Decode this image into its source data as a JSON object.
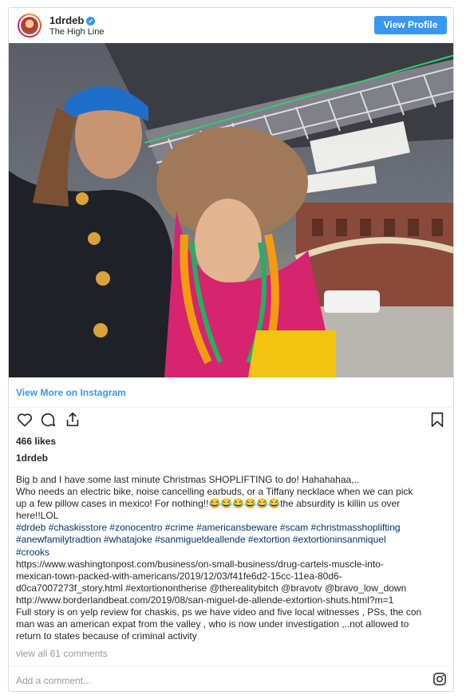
{
  "post": {
    "username": "1drdeb",
    "location": "The High Line",
    "view_profile_label": "View Profile",
    "view_more_label": "View More on Instagram",
    "likes": "466 likes",
    "owner": "1drdeb",
    "caption_lines": [
      "Big b and I have some last minute Christmas SHOPLIFTING to do! Hahahahaa,..",
      "Who needs an electric bike, noise cancelling earbuds, or a Tiffany necklace when we can pick",
      "up a few pillow cases in mexico! For nothing!!😂😂😂😂😂😂the absurdity is killin us over",
      "here!!LOL",
      "#drdeb #chaskisstore #zonocentro #crime #americansbeware #scam #christmasshoplifting",
      "#anewfamilytradtion #whatajoke #sanmigueldeallende #extortion #extortioninsanmiquel",
      "#crooks",
      "https://www.washingtonpost.com/business/on-small-business/drug-cartels-muscle-into-",
      "mexican-town-packed-with-americans/2019/12/03/f41fe6d2-15cc-11ea-80d6-",
      "d0ca7007273f_story.html #extortionontherise @therealitybitch @bravotv @bravo_low_down",
      "http://www.borderlandbeat.com/2019/08/san-miguel-de-allende-extortion-shuts.html?m=1",
      "Full story is on yelp review for chaskis, ps we have video and five local witnesses , PSs, the con",
      "man was an american expat from the valley , who is now under investigation ,..not allowed to",
      "return to states because of criminal activity"
    ],
    "comments_link": "view all 61 comments",
    "add_comment_placeholder": "Add a comment...",
    "colors": {
      "accent": "#3897f0",
      "hashtag": "#003569",
      "muted": "#999999"
    },
    "icons": [
      "heart-icon",
      "comment-icon",
      "share-icon",
      "bookmark-icon",
      "instagram-icon",
      "verified-badge-icon"
    ]
  }
}
